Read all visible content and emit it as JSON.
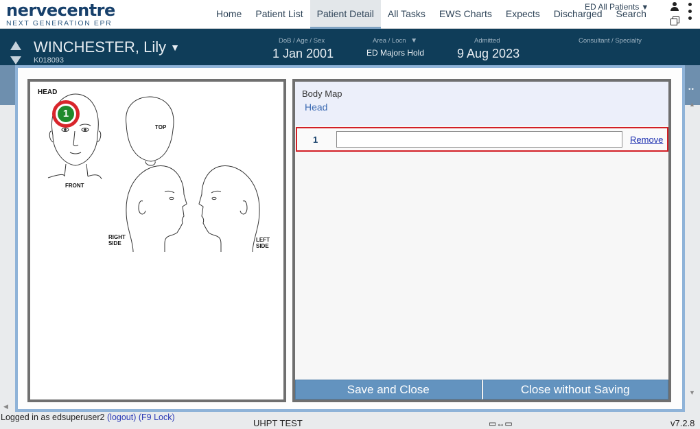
{
  "app": {
    "logo_text": "nervecentre",
    "logo_subtitle": "NEXT GENERATION EPR"
  },
  "nav": {
    "items": [
      {
        "label": "Home",
        "active": false
      },
      {
        "label": "Patient List",
        "active": false
      },
      {
        "label": "Patient Detail",
        "active": true
      },
      {
        "label": "All Tasks",
        "active": false
      },
      {
        "label": "EWS Charts",
        "active": false
      },
      {
        "label": "Expects",
        "active": false
      },
      {
        "label": "Discharged",
        "active": false
      },
      {
        "label": "Search",
        "active": false
      }
    ],
    "ward_filter": "ED All Patients",
    "icons": [
      "user-icon",
      "windows-icon",
      "more-menu-icon"
    ]
  },
  "patient": {
    "name": "WINCHESTER, Lily",
    "id": "K018093",
    "dob_label": "DoB / Age / Sex",
    "dob_value": "1 Jan 2001",
    "area_label": "Area / Locn",
    "area_value": "ED Majors Hold",
    "admitted_label": "Admitted",
    "admitted_value": "9 Aug 2023",
    "consultant_label": "Consultant / Specialty",
    "consultant_value": ""
  },
  "body_map": {
    "diagram_title": "HEAD",
    "views": {
      "top": "TOP",
      "front": "FRONT",
      "right_line1": "RIGHT",
      "right_line2": "SIDE",
      "left_line1": "LEFT",
      "left_line2": "SIDE"
    },
    "markers": [
      {
        "number": "1",
        "color": "#1f8a2c",
        "ring": "#d8252b"
      }
    ],
    "panel_title": "Body Map",
    "region": "Head",
    "entries": [
      {
        "number": "1",
        "value": "",
        "remove_label": "Remove"
      }
    ],
    "save_label": "Save and Close",
    "close_label": "Close without Saving"
  },
  "footer": {
    "login_prefix": "Logged in as edsuperuser2",
    "logout_label": "(logout)",
    "lock_label": "(F9 Lock)",
    "environment": "UHPT TEST",
    "version": "v7.2.8"
  },
  "colors": {
    "brand": "#17406b",
    "banner": "#0f3d59",
    "accent": "#6393bf",
    "marker_green": "#1f8a2c",
    "highlight_red": "#d21e25"
  }
}
